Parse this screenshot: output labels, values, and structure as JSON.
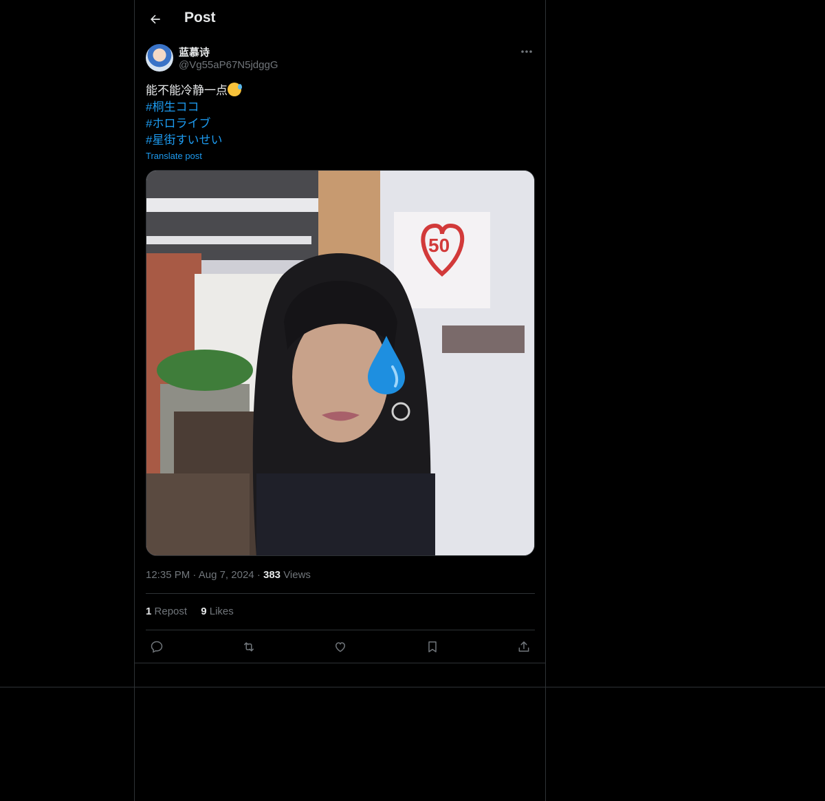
{
  "header": {
    "title": "Post"
  },
  "author": {
    "display_name": "蓝慕诗",
    "handle": "@Vg55aP67N5jdggG"
  },
  "post": {
    "text": "能不能冷静一点",
    "emoji": "grinning-face-with-sweat",
    "hashtags": [
      "#桐生ココ",
      "#ホロライブ",
      "#星街すいせい"
    ],
    "translate_label": "Translate post"
  },
  "meta": {
    "time": "12:35 PM",
    "date": "Aug 7, 2024",
    "views_count": "383",
    "views_label": "Views",
    "dot": "·"
  },
  "stats": {
    "reposts_count": "1",
    "reposts_label": "Repost",
    "likes_count": "9",
    "likes_label": "Likes"
  },
  "icons": [
    "back-arrow-icon",
    "more-icon",
    "reply-icon",
    "repost-icon",
    "like-icon",
    "bookmark-icon",
    "share-icon"
  ],
  "colors": {
    "background": "#000000",
    "text": "#e7e9ea",
    "secondary": "#71767b",
    "accent": "#1d9bf0",
    "border": "#2f3336"
  }
}
